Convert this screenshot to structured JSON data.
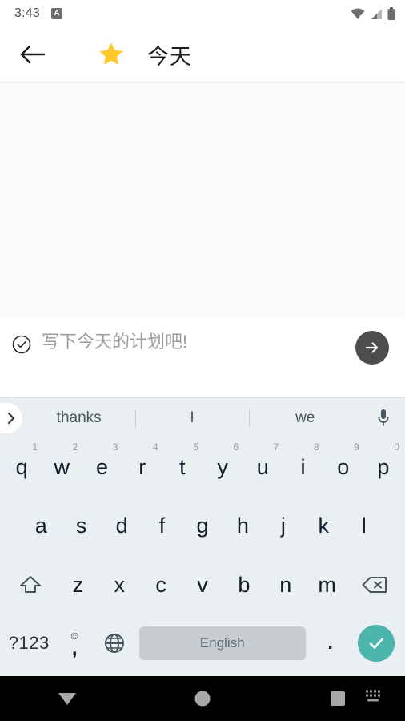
{
  "status_bar": {
    "time": "3:43",
    "badge_label": "A",
    "icons": [
      "wifi-off-icon",
      "cellular-signal-icon",
      "battery-icon"
    ]
  },
  "app_bar": {
    "back_icon": "arrow-left-icon",
    "star_icon": "star-icon",
    "title": "今天",
    "star_color": "#FFC928"
  },
  "input_row": {
    "check_icon": "check-circle-icon",
    "placeholder": "写下今天的计划吧!",
    "value": "",
    "send_icon": "arrow-right-icon",
    "send_bg": "#4D4D4D"
  },
  "keyboard": {
    "expand_icon": "chevron-right-icon",
    "suggestions": [
      "thanks",
      "I",
      "we"
    ],
    "mic_icon": "microphone-icon",
    "row1": [
      {
        "key": "q",
        "num": "1"
      },
      {
        "key": "w",
        "num": "2"
      },
      {
        "key": "e",
        "num": "3"
      },
      {
        "key": "r",
        "num": "4"
      },
      {
        "key": "t",
        "num": "5"
      },
      {
        "key": "y",
        "num": "6"
      },
      {
        "key": "u",
        "num": "7"
      },
      {
        "key": "i",
        "num": "8"
      },
      {
        "key": "o",
        "num": "9"
      },
      {
        "key": "p",
        "num": "0"
      }
    ],
    "row2": [
      "a",
      "s",
      "d",
      "f",
      "g",
      "h",
      "j",
      "k",
      "l"
    ],
    "row3": [
      "z",
      "x",
      "c",
      "v",
      "b",
      "n",
      "m"
    ],
    "shift_icon": "shift-icon",
    "backspace_icon": "backspace-icon",
    "numeric_label": "?123",
    "emoji_glyph": "☺",
    "comma_label": ",",
    "globe_icon": "globe-icon",
    "space_label": "English",
    "period_label": ".",
    "enter_icon": "check-icon",
    "enter_bg": "#4DB6AC",
    "bg_color": "#EAEFF1",
    "space_bg": "#C7CDD0"
  },
  "nav_bar": {
    "back_icon": "triangle-down-icon",
    "home_icon": "circle-icon",
    "recents_icon": "square-icon",
    "keyboard_indicator_icon": "keyboard-icon"
  }
}
